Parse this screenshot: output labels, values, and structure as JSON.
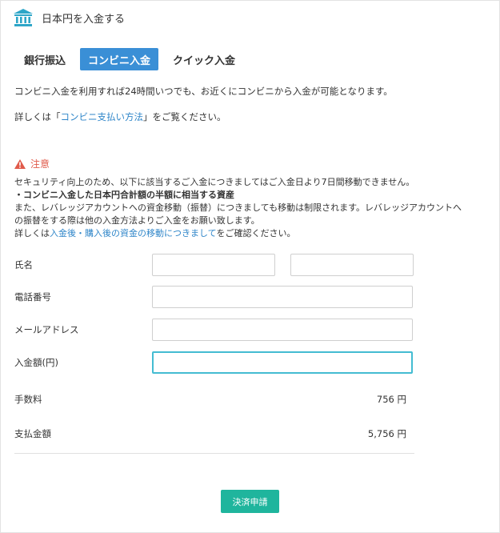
{
  "header": {
    "title": "日本円を入金する",
    "icon": "bank-icon",
    "accent": "#2ea6c8"
  },
  "tabs": [
    {
      "label": "銀行振込",
      "active": false
    },
    {
      "label": "コンビニ入金",
      "active": true
    },
    {
      "label": "クイック入金",
      "active": false
    }
  ],
  "intro": "コンビニ入金を利用すれば24時間いつでも、お近くにコンビニから入金が可能となります。",
  "details": {
    "prefix": "詳しくは「",
    "link": "コンビニ支払い方法",
    "suffix": "」をご覧ください。"
  },
  "caution": {
    "title": "注意",
    "line1": "セキュリティ向上のため、以下に該当するご入金につきましてはご入金日より7日間移動できません。",
    "bold_line": "・コンビニ入金した日本円合計額の半額に相当する資産",
    "line3": "また、レバレッジアカウントへの資金移動（振替）につきましても移動は制限されます。レバレッジアカウントへ",
    "line4": "の振替をする際は他の入金方法よりご入金をお願い致します。",
    "line5_prefix": "詳しくは",
    "line5_link": "入金後・購入後の資金の移動につきまして",
    "line5_suffix": "をご確認ください。"
  },
  "form": {
    "name_label": "氏名",
    "phone_label": "電話番号",
    "email_label": "メールアドレス",
    "amount_label": "入金額(円)",
    "fee_label": "手数料",
    "fee_value": "756 円",
    "total_label": "支払金額",
    "total_value": "5,756 円"
  },
  "submit_label": "決済申請",
  "colors": {
    "tab_active": "#3a8fd6",
    "link": "#2f86c9",
    "caution": "#e05a4a",
    "submit": "#1fb59d",
    "focus": "#44bcd2"
  }
}
